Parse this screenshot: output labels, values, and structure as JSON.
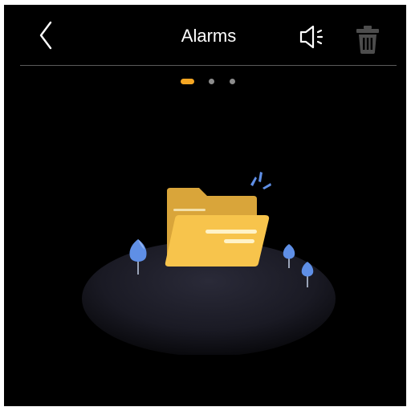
{
  "header": {
    "title": "Alarms",
    "back_icon": "chevron-left-icon",
    "speaker_icon": "speaker-icon",
    "trash_icon": "trash-icon"
  },
  "pager": {
    "page_count": 3,
    "active_index": 0
  },
  "colors": {
    "background": "#000000",
    "text": "#ffffff",
    "divider": "#5a5a5a",
    "accent": "#f5a623",
    "dot_inactive": "#8c8c8c",
    "trash_disabled": "#4d4d4d",
    "folder": "#f7c44c",
    "leaf": "#5f8fe6"
  },
  "illustration": {
    "icon": "empty-folder-icon"
  }
}
